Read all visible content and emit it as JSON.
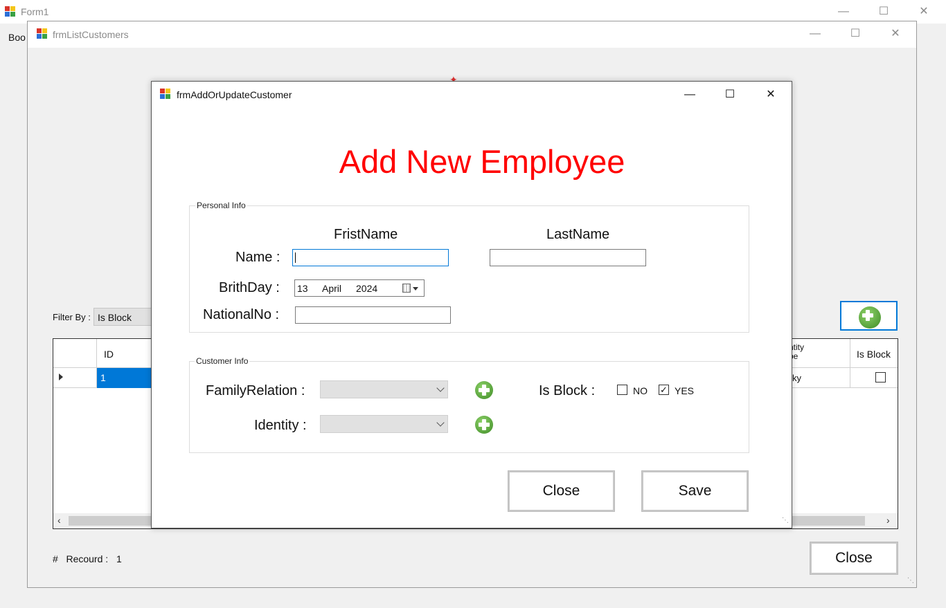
{
  "form1": {
    "title": "Form1",
    "menu_partial": "Boo"
  },
  "list_window": {
    "title": "frmListCustomers",
    "filter_label": "Filter By :",
    "filter_value": "Is Block",
    "grid": {
      "columns": [
        "ID",
        "ntity\npe",
        "Is Block"
      ],
      "row": {
        "id": "1",
        "identity_partial": "ky",
        "is_block": false
      }
    },
    "record_label": "#   Recourd :",
    "record_count": "1",
    "close_label": "Close"
  },
  "dialog": {
    "title": "frmAddOrUpdateCustomer",
    "heading": "Add New Employee",
    "personal_group": "Personal Info",
    "first_name_header": "FristName",
    "last_name_header": "LastName",
    "name_label": "Name :",
    "first_name_value": "",
    "last_name_value": "",
    "birthday_label": "BrithDay :",
    "birthday_day": "13",
    "birthday_month": "April",
    "birthday_year": "2024",
    "national_label": "NationalNo :",
    "national_value": "",
    "customer_group": "Customer Info",
    "family_label": "FamilyRelation :",
    "family_value": "",
    "identity_label": "Identity :",
    "identity_value": "",
    "isblock_label": "Is Block :",
    "no_label": "NO",
    "no_checked": false,
    "yes_label": "YES",
    "yes_checked": true,
    "close_label": "Close",
    "save_label": "Save"
  },
  "colors": {
    "heading": "#ff0000",
    "selection": "#0078d7",
    "accent_border": "#0078d7"
  }
}
